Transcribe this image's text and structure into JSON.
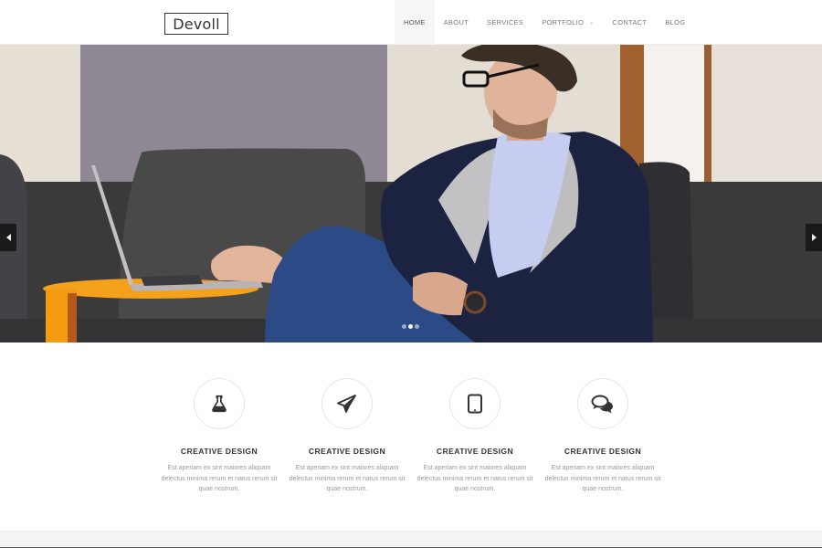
{
  "site": {
    "logo": "Devoll"
  },
  "nav": {
    "items": [
      {
        "label": "HOME",
        "active": true
      },
      {
        "label": "ABOUT",
        "active": false
      },
      {
        "label": "SERVICES",
        "active": false
      },
      {
        "label": "PORTFOLIO",
        "active": false,
        "has_dropdown": true
      },
      {
        "label": "CONTACT",
        "active": false
      },
      {
        "label": "BLOG",
        "active": false
      }
    ],
    "dropdown_caret": "⌄"
  },
  "hero": {
    "image_description": "Man with glasses in navy hoodie sitting on grey sofa using a laptop on an orange side table",
    "slides_count": 3,
    "active_slide": 2,
    "prev_icon": "triangle-left-icon",
    "next_icon": "triangle-right-icon"
  },
  "features": [
    {
      "icon": "flask-icon",
      "title": "CREATIVE DESIGN",
      "text": "Est aperiam ex sint maiores aliquam delectus minima rerum et natus rerum sit quae nostrum."
    },
    {
      "icon": "paper-plane-icon",
      "title": "CREATIVE DESIGN",
      "text": "Est aperiam ex sint maiores aliquam delectus minima rerum et natus rerum sit quae nostrum."
    },
    {
      "icon": "tablet-icon",
      "title": "CREATIVE DESIGN",
      "text": "Est aperiam ex sint maiores aliquam delectus minima rerum et natus rerum sit quae nostrum."
    },
    {
      "icon": "chat-bubbles-icon",
      "title": "CREATIVE DESIGN",
      "text": "Est aperiam ex sint maiores aliquam delectus minima rerum et natus rerum sit quae nostrum."
    }
  ],
  "colors": {
    "text_dark": "#333333",
    "text_muted": "#999999",
    "nav_active_bg": "#f6f6f6",
    "table_orange": "#f39c12"
  }
}
